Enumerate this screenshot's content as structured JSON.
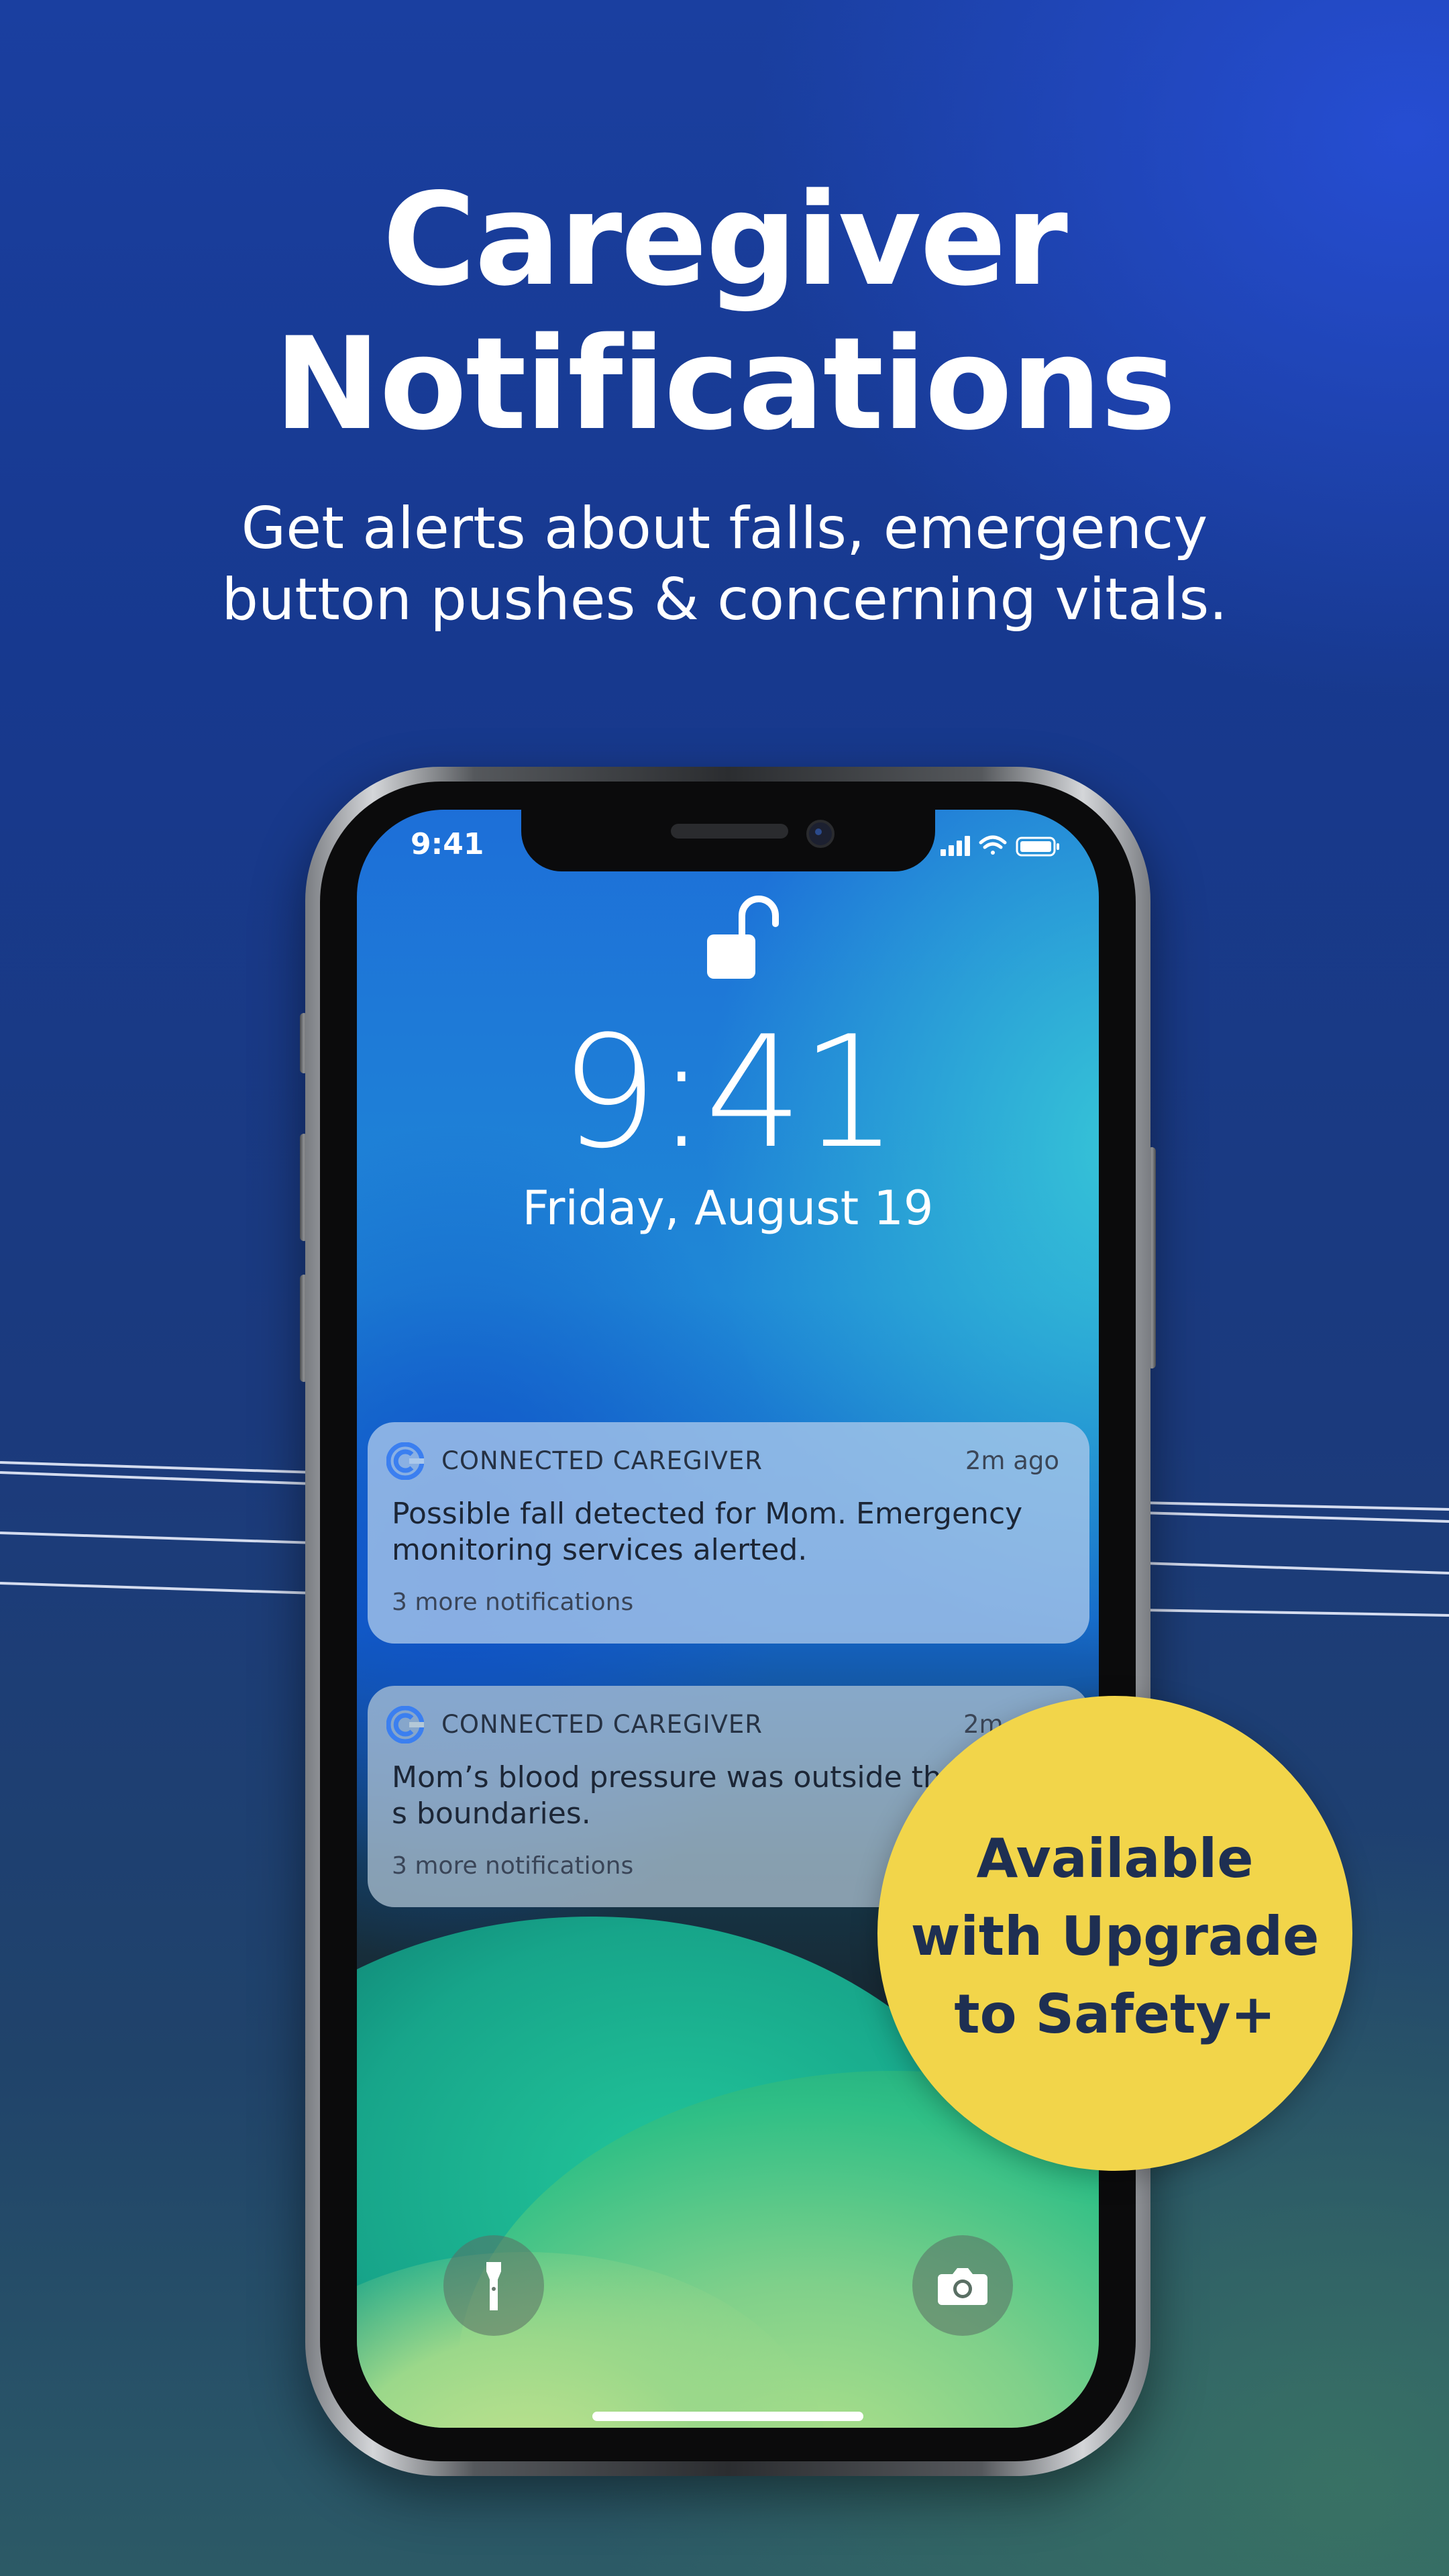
{
  "headline": {
    "line1": "Caregiver",
    "line2": "Notifications"
  },
  "subhead": {
    "line1": "Get alerts about falls, emergency",
    "line2": "button pushes & concerning vitals."
  },
  "phone": {
    "status_time": "9:41",
    "lock_time": "9:41",
    "lock_date": "Friday, August 19"
  },
  "notifications": [
    {
      "app": "CONNECTED CAREGIVER",
      "time": "2m ago",
      "body": "Possible fall detected for Mom. Emergency monitoring services alerted.",
      "more": "3 more notifications"
    },
    {
      "app": "CONNECTED CAREGIVER",
      "time": "2m",
      "body": "Mom’s blood pressure was outside the s boundaries.",
      "more": "3 more notifications"
    }
  ],
  "badge": {
    "line1": "Available",
    "line2": "with Upgrade",
    "line3": "to Safety+"
  },
  "colors": {
    "badge": "#f2d54a",
    "badge_text": "#1e2f52",
    "app_icon": "#3b7ff0"
  },
  "icons": [
    "lock-open-icon",
    "flashlight-icon",
    "camera-icon",
    "signal-icon",
    "wifi-icon",
    "battery-icon",
    "app-logo-icon"
  ]
}
